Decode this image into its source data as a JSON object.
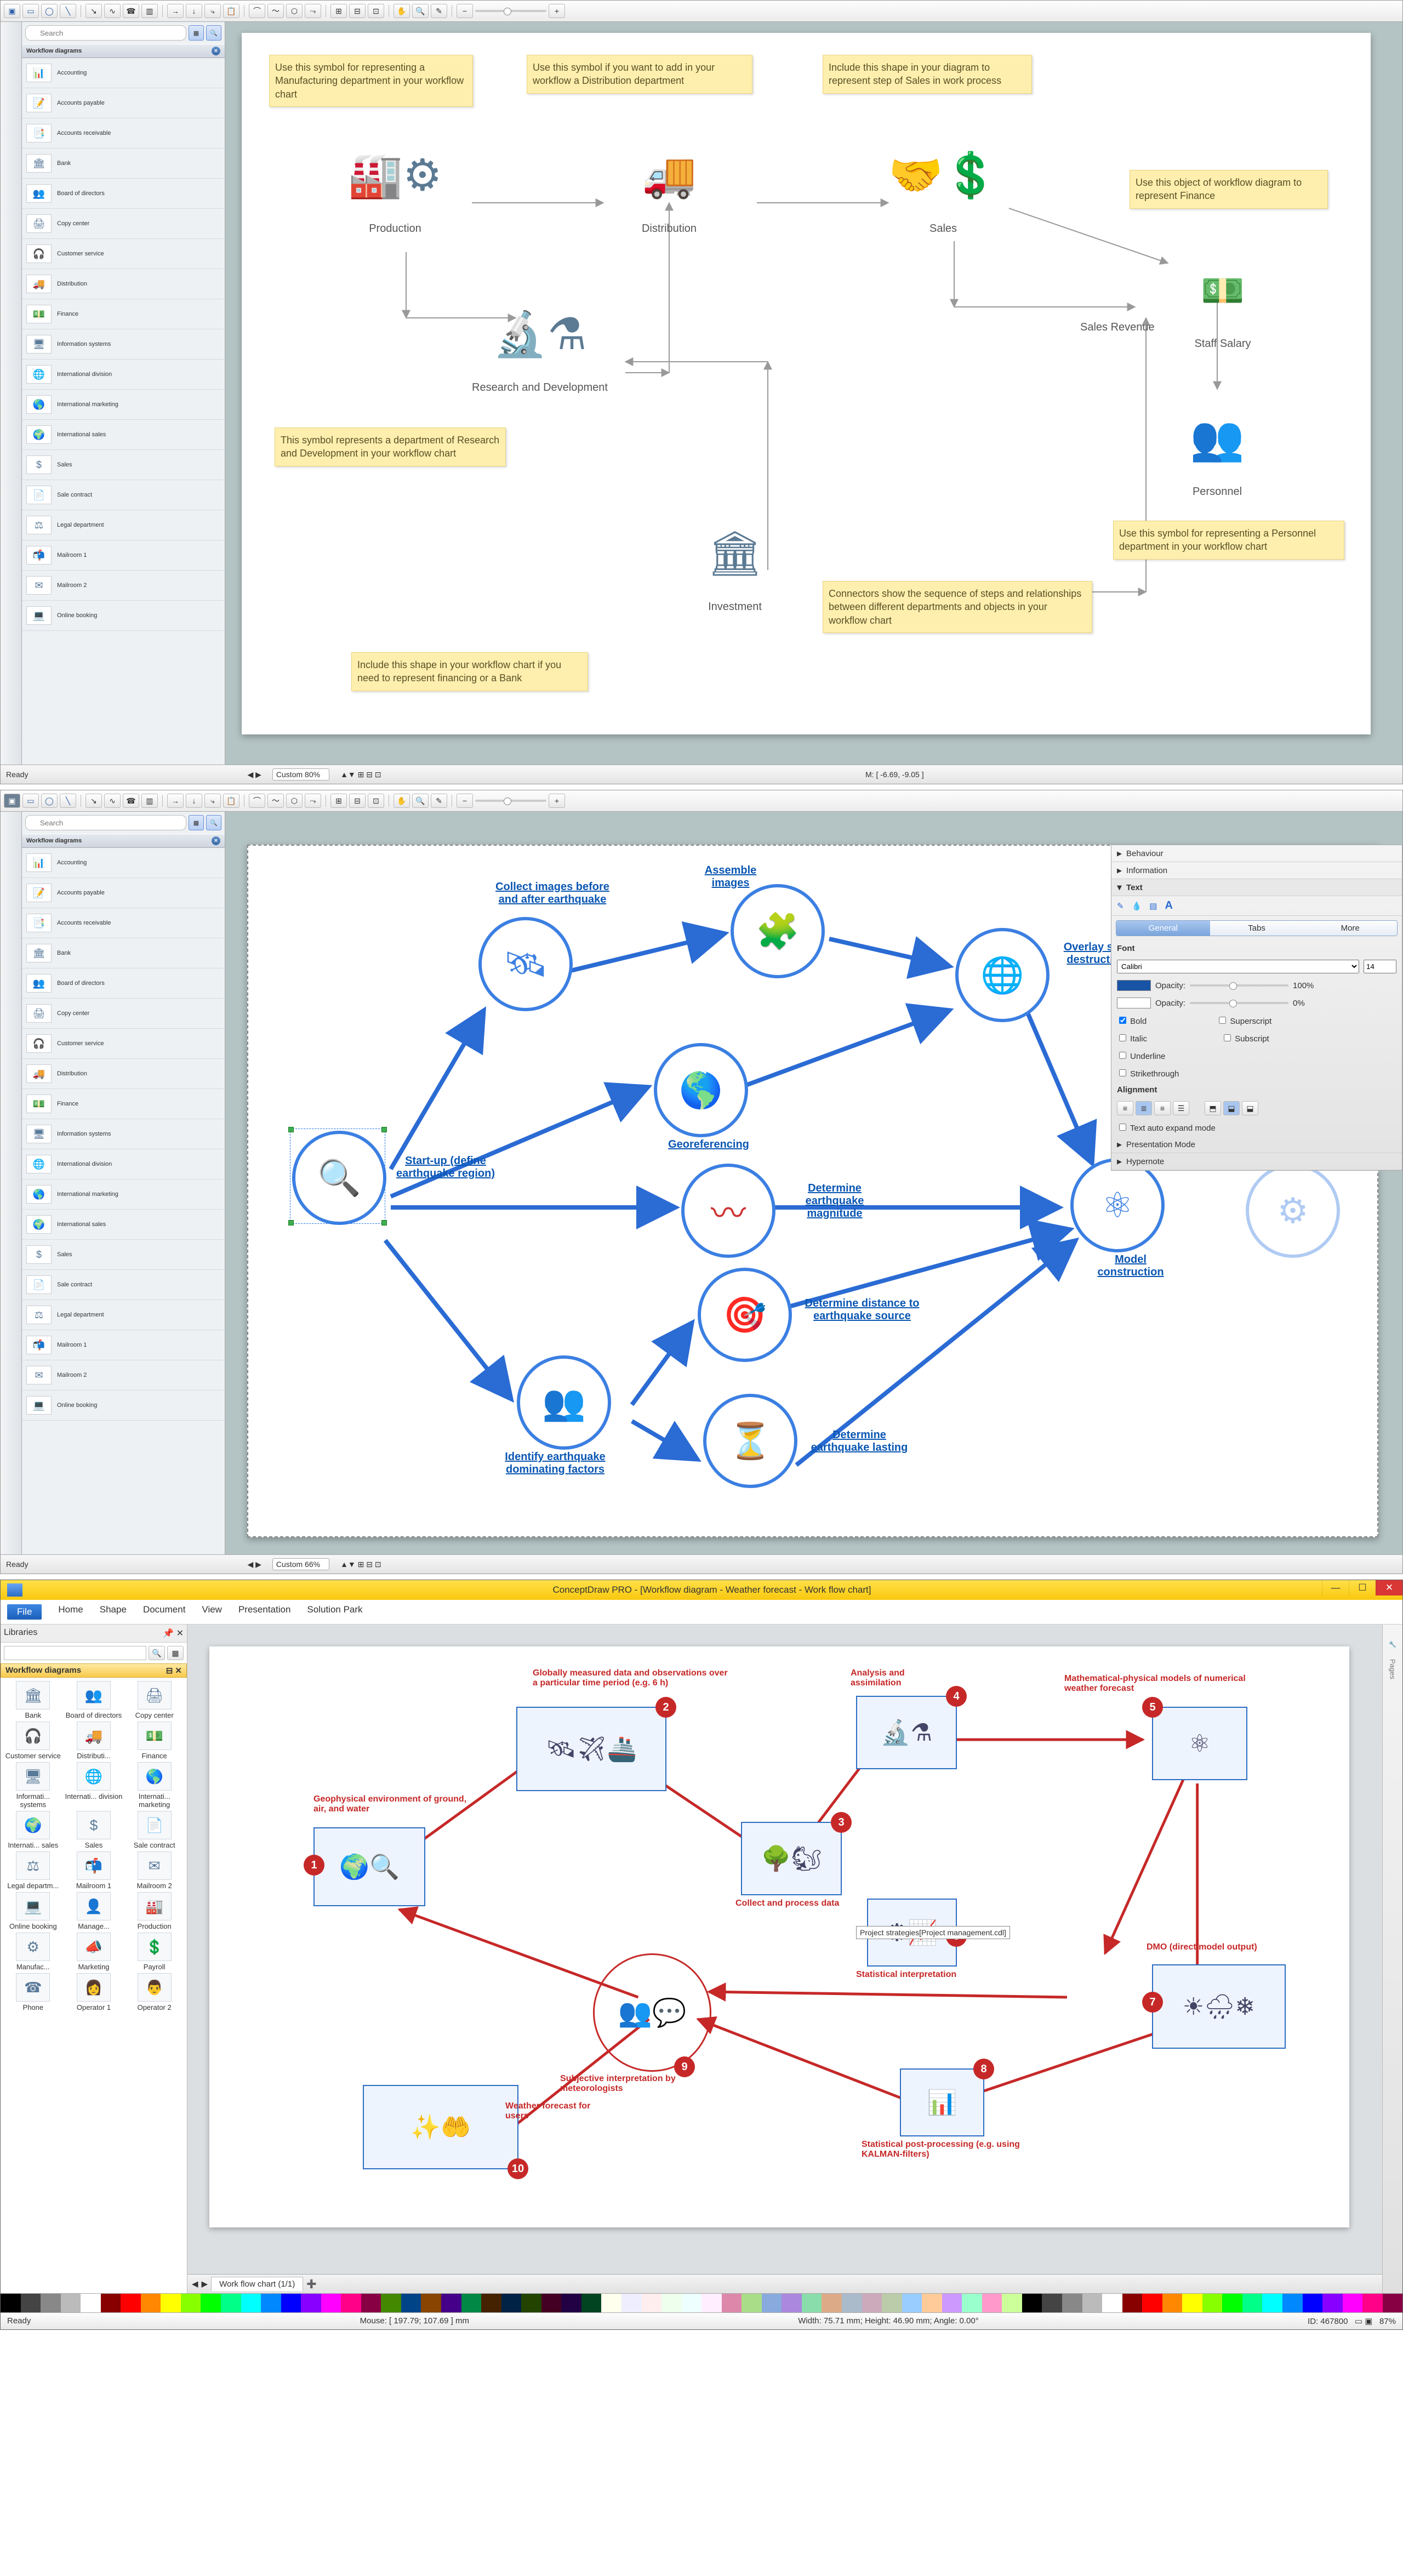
{
  "sec1": {
    "search_ph": "Search",
    "lib_title": "Workflow diagrams",
    "items": [
      {
        "label": "Accounting",
        "icon": "📊"
      },
      {
        "label": "Accounts payable",
        "icon": "📝"
      },
      {
        "label": "Accounts receivable",
        "icon": "📑"
      },
      {
        "label": "Bank",
        "icon": "🏛"
      },
      {
        "label": "Board of directors",
        "icon": "👥"
      },
      {
        "label": "Copy center",
        "icon": "🖨"
      },
      {
        "label": "Customer service",
        "icon": "🎧"
      },
      {
        "label": "Distribution",
        "icon": "🚚"
      },
      {
        "label": "Finance",
        "icon": "💵"
      },
      {
        "label": "Information systems",
        "icon": "🖥"
      },
      {
        "label": "International division",
        "icon": "🌐"
      },
      {
        "label": "International marketing",
        "icon": "🌎"
      },
      {
        "label": "International sales",
        "icon": "🌍"
      },
      {
        "label": "Sales",
        "icon": "$"
      },
      {
        "label": "Sale contract",
        "icon": "📄"
      },
      {
        "label": "Legal department",
        "icon": "⚖"
      },
      {
        "label": "Mailroom 1",
        "icon": "📬"
      },
      {
        "label": "Mailroom 2",
        "icon": "✉"
      },
      {
        "label": "Online booking",
        "icon": "💻"
      }
    ],
    "notes": {
      "n1": "Use this symbol for representing a Manufacturing department in your workflow chart",
      "n2": "Use this symbol if you want to add in your workflow a Distribution department",
      "n3": "Include this shape in your diagram to represent step of Sales in work process",
      "n4": "Use this object of workflow diagram to represent Finance",
      "n5": "This symbol represents a department of Research and Development in your workflow chart",
      "n6": "Use this symbol for representing a Personnel department in your workflow chart",
      "n7": "Connectors show the sequence of steps and relationships between different departments and objects in your workflow chart",
      "n8": "Include this shape in your workflow chart if you need to represent financing or a Bank"
    },
    "nodes": {
      "production": "Production",
      "distribution": "Distribution",
      "sales": "Sales",
      "staffsalary": "Staff Salary",
      "salesrevenue": "Sales Revenue",
      "rnd": "Research and Development",
      "personnel": "Personnel",
      "investment": "Investment"
    },
    "status": {
      "ready": "Ready",
      "zoom": "Custom 80%",
      "mouse": "M: [ -6.69, -9.05 ]"
    }
  },
  "sec2": {
    "search_ph": "Search",
    "lib_title": "Workflow diagrams",
    "items_same_as_sec1": true,
    "nodes": {
      "startup": "Start-up (define earthquake region)",
      "collect": "Collect images before and after earthquake",
      "assemble": "Assemble images",
      "overlay": "Overlay satellite and destruction images",
      "georef": "Georeferencing",
      "magnitude": "Determine earthquake magnitude",
      "model": "Model construction",
      "distance": "Determine distance to earthquake source",
      "lasting": "Determine earthquake lasting",
      "identify": "Identify earthquake dominating factors"
    },
    "prop": {
      "behaviour": "Behaviour",
      "information": "Information",
      "text": "Text",
      "tabs": [
        "General",
        "Tabs",
        "More"
      ],
      "font_label": "Font",
      "font_value": "Calibri",
      "font_size": "14",
      "opacity_label": "Opacity:",
      "opacity1": "100%",
      "opacity2": "0%",
      "bold": "Bold",
      "italic": "Italic",
      "underline": "Underline",
      "strike": "Strikethrough",
      "super": "Superscript",
      "sub": "Subscript",
      "alignment": "Alignment",
      "autoexp": "Text auto expand mode",
      "pres": "Presentation Mode",
      "hyper": "Hypernote"
    },
    "status": {
      "ready": "Ready",
      "zoom": "Custom 66%"
    }
  },
  "sec3": {
    "title": "ConceptDraw PRO - [Workflow diagram - Weather forecast - Work flow chart]",
    "menu": [
      "File",
      "Home",
      "Shape",
      "Document",
      "View",
      "Presentation",
      "Solution Park"
    ],
    "libs_label": "Libraries",
    "cat": "Workflow diagrams",
    "griditems": [
      {
        "l": "Bank",
        "i": "🏛"
      },
      {
        "l": "Board of directors",
        "i": "👥"
      },
      {
        "l": "Copy center",
        "i": "🖨"
      },
      {
        "l": "Customer service",
        "i": "🎧"
      },
      {
        "l": "Distributi...",
        "i": "🚚"
      },
      {
        "l": "Finance",
        "i": "💵"
      },
      {
        "l": "Informati... systems",
        "i": "🖥"
      },
      {
        "l": "Internati... division",
        "i": "🌐"
      },
      {
        "l": "Internati... marketing",
        "i": "🌎"
      },
      {
        "l": "Internati... sales",
        "i": "🌍"
      },
      {
        "l": "Sales",
        "i": "$"
      },
      {
        "l": "Sale contract",
        "i": "📄"
      },
      {
        "l": "Legal departm...",
        "i": "⚖"
      },
      {
        "l": "Mailroom 1",
        "i": "📬"
      },
      {
        "l": "Mailroom 2",
        "i": "✉"
      },
      {
        "l": "Online booking",
        "i": "💻"
      },
      {
        "l": "Manage...",
        "i": "👤"
      },
      {
        "l": "Production",
        "i": "🏭"
      },
      {
        "l": "Manufac...",
        "i": "⚙"
      },
      {
        "l": "Marketing",
        "i": "📣"
      },
      {
        "l": "Payroll",
        "i": "💲"
      },
      {
        "l": "Phone",
        "i": "☎"
      },
      {
        "l": "Operator 1",
        "i": "👩"
      },
      {
        "l": "Operator 2",
        "i": "👨"
      }
    ],
    "wflabels": {
      "l1": "Geophysical environment of ground, air, and water",
      "l2": "Globally measured data and observations over a particular time period (e.g. 6 h)",
      "l3": "Collect and process data",
      "l4": "Analysis and assimilation",
      "l5": "Mathematical-physical models of numerical weather forecast",
      "l6": "Project strategies[Project management.cdl]",
      "l7": "DMO (direct model output)",
      "l8": "Statistical post-processing (e.g. using KALMAN-filters)",
      "l9": "Subjective interpretation by meteorologists",
      "l9b": "Statistical interpretation",
      "l10": "Weather forecast for users"
    },
    "tab": "Work flow chart (1/1)",
    "status": {
      "ready": "Ready",
      "mouse": "Mouse: [ 197.79; 107.69 ] mm",
      "size": "Width: 75.71 mm; Height: 46.90 mm;  Angle: 0.00°",
      "id": "ID: 467800",
      "zoom": "87%"
    },
    "right_tab": "Pages"
  }
}
